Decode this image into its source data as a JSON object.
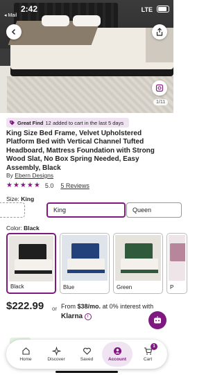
{
  "status_bar": {
    "time": "2:42",
    "back_app": "◂ Mail",
    "network": "LTE"
  },
  "gallery": {
    "counter": "1/11"
  },
  "banner": {
    "label": "Great Find",
    "text": "12 added to cart in the last 5 days"
  },
  "product": {
    "title": "King Size Bed Frame, Velvet Upholstered Platform Bed with Vertical Channel Tufted Headboard,  Mattress Foundation with Strong Wood Slat, No Box Spring Needed, Easy Assembly, Black",
    "brand_prefix": "By",
    "brand": "Ebern Designs",
    "stars": "★★★★★",
    "rating": "5.0",
    "reviews": "5 Reviews"
  },
  "size": {
    "label": "Size:",
    "selected": "King",
    "options": [
      "",
      "King",
      "Queen"
    ]
  },
  "color": {
    "label": "Color:",
    "selected": "Black",
    "options": [
      {
        "name": "Black",
        "color": "#1f1f1f"
      },
      {
        "name": "Blue",
        "color": "#23417a"
      },
      {
        "name": "Green",
        "color": "#2f5a3c"
      },
      {
        "name": "P",
        "color": "#b8869a"
      }
    ]
  },
  "pricing": {
    "price": "$222.99",
    "or": "or",
    "finance_prefix": "From",
    "finance_amount": "$38/mo.",
    "finance_suffix": "at 0% interest with",
    "provider": "Klarna",
    "info": "i"
  },
  "nav": {
    "items": [
      {
        "label": "Home"
      },
      {
        "label": "Discover"
      },
      {
        "label": "Saved"
      },
      {
        "label": "Account"
      },
      {
        "label": "Cart"
      }
    ],
    "cart_count": "1"
  },
  "colors": {
    "accent": "#7f187f",
    "banner_bg": "#efe3f2"
  }
}
